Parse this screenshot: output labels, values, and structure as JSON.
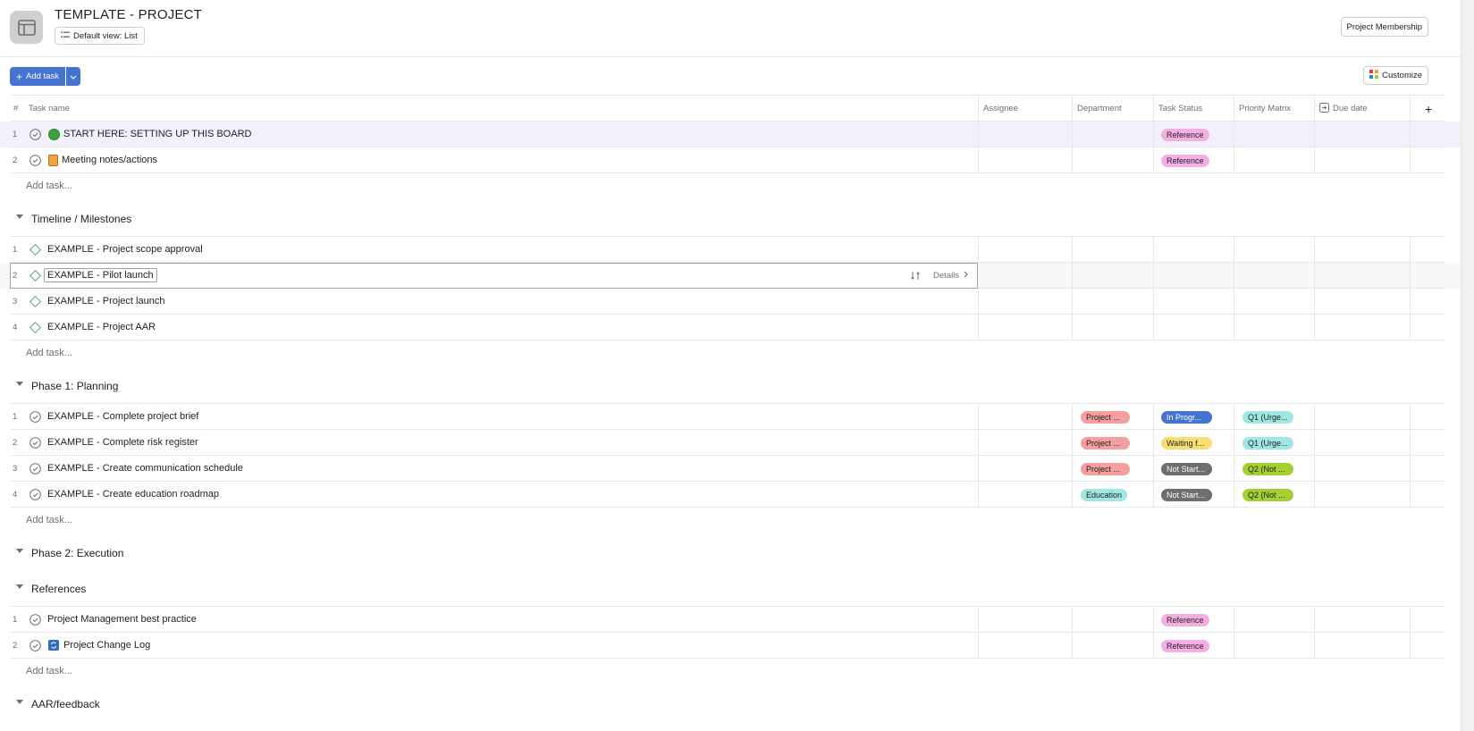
{
  "header": {
    "project_title": "TEMPLATE - PROJECT",
    "view_label": "Default view: List",
    "membership_label": "Project Membership"
  },
  "toolbar": {
    "add_task_label": "Add task",
    "customize_label": "Customize"
  },
  "columns": {
    "num": "#",
    "task_name": "Task name",
    "assignee": "Assignee",
    "department": "Department",
    "task_status": "Task Status",
    "priority_matrix": "Priority Matrix",
    "due_date": "Due date",
    "add_column": "+"
  },
  "add_task_placeholder": "Add task...",
  "details_label": "Details",
  "untitled_section": {
    "tasks": [
      {
        "num": "1",
        "name": "START HERE: SETTING UP THIS BOARD",
        "status": "Reference"
      },
      {
        "num": "2",
        "name": "Meeting notes/actions",
        "status": "Reference"
      }
    ]
  },
  "sections": [
    {
      "title": "Timeline / Milestones",
      "tasks": [
        {
          "num": "1",
          "name": "EXAMPLE - Project scope approval"
        },
        {
          "num": "2",
          "name": "EXAMPLE - Pilot launch"
        },
        {
          "num": "3",
          "name": "EXAMPLE - Project launch"
        },
        {
          "num": "4",
          "name": "EXAMPLE - Project AAR"
        }
      ]
    },
    {
      "title": "Phase 1: Planning",
      "tasks": [
        {
          "num": "1",
          "name": "EXAMPLE - Complete project brief",
          "department": "Project ...",
          "status": "In Progr...",
          "priority": "Q1 (Urge..."
        },
        {
          "num": "2",
          "name": "EXAMPLE - Complete risk register",
          "department": "Project ...",
          "status": "Waiting f...",
          "priority": "Q1 (Urge..."
        },
        {
          "num": "3",
          "name": "EXAMPLE - Create communication schedule",
          "department": "Project ...",
          "status": "Not Start...",
          "priority": "Q2 (Not ..."
        },
        {
          "num": "4",
          "name": "EXAMPLE - Create education roadmap",
          "department": "Education",
          "status": "Not Start...",
          "priority": "Q2 (Not ..."
        }
      ]
    },
    {
      "title": "Phase 2: Execution",
      "tasks": []
    },
    {
      "title": "References",
      "tasks": [
        {
          "num": "1",
          "name": "Project Management best practice",
          "status": "Reference"
        },
        {
          "num": "2",
          "name": "Project Change Log",
          "status": "Reference"
        }
      ]
    },
    {
      "title": "AAR/feedback",
      "tasks": []
    }
  ],
  "colors": {
    "accent": "#4573d2",
    "reference": "#f5aee4",
    "project_dept": "#f69f9f",
    "education_dept": "#9ee7e3",
    "in_progress": "#4573d2",
    "waiting": "#f8df72",
    "not_started": "#6d6e6f",
    "q1": "#9ee7e3",
    "q2": "#a4cf30",
    "milestone": "#58a182",
    "start_here_dot": "#3ca43c",
    "notes_icon": "#f1a43b",
    "changelog_icon": "#2f6fb7"
  },
  "icons": {
    "project": "layout-icon",
    "view": "list-icon",
    "add": "plus-icon",
    "dropdown": "chevron-down-icon",
    "customize": "grid-icon",
    "task_check": "check-circle-icon",
    "milestone": "diamond-icon",
    "section": "caret-down-icon",
    "subtask": "subtask-icon",
    "details": "chevron-right-icon"
  }
}
